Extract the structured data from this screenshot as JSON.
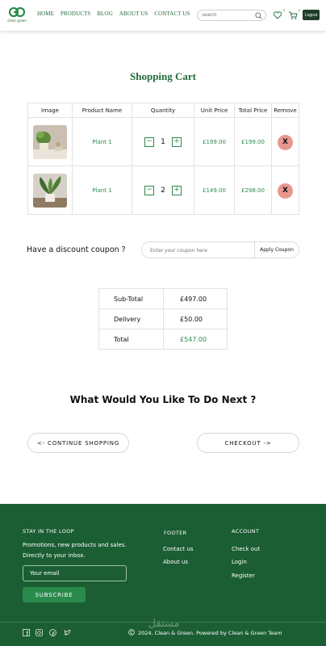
{
  "brand": {
    "name": "clean green",
    "accent": "#1f6b3a",
    "footer_bg": "#1b5e33"
  },
  "nav": {
    "items": [
      "HOME",
      "PRODUCTS",
      "BLOG",
      "ABOUT US",
      "CONTACT US"
    ]
  },
  "search": {
    "placeholder": "search",
    "icon": "search-icon"
  },
  "header_icons": {
    "wishlist_count": "0",
    "cart_count": "0"
  },
  "logout_label": "Logout",
  "page_title": "Shopping Cart",
  "cart": {
    "headers": [
      "Image",
      "Product Name",
      "Quantity",
      "Unit Price",
      "Total Price",
      "Remove"
    ],
    "rows": [
      {
        "name": "Plant 1",
        "qty": "1",
        "unit_price": "£199.00",
        "total_price": "£199.00",
        "remove": "X",
        "minus": "−",
        "plus": "+"
      },
      {
        "name": "Plant 1",
        "qty": "2",
        "unit_price": "£149.00",
        "total_price": "£298.00",
        "remove": "X",
        "minus": "−",
        "plus": "+"
      }
    ]
  },
  "coupon": {
    "label": "Have a discount coupon ?",
    "placeholder": "Enter your coupon here",
    "button": "Apply Coupon"
  },
  "totals": {
    "subtotal_label": "Sub-Total",
    "subtotal": "£497.00",
    "delivery_label": "Delivery",
    "delivery": "£50.00",
    "total_label": "Total",
    "total": "£547.00"
  },
  "next": {
    "title": "What Would You Like To Do Next ?",
    "continue": "<- CONTINUE SHOPPING",
    "checkout": "CHECKOUT ->"
  },
  "footer": {
    "loop_heading": "STAY IN THE LOOP",
    "loop_text": "Promotions, new products and sales. Directly to your inbox.",
    "email_placeholder": "Your email",
    "subscribe": "SUBSCRIBE",
    "footer_heading": "FOOTER",
    "footer_links": [
      "Contact us",
      "About us"
    ],
    "account_heading": "ACCOUNT",
    "account_links": [
      "Check out",
      "Login",
      "Register"
    ],
    "copyright": "2024, Clean & Green. Powered by Clean & Green Team",
    "social_icons": [
      "facebook-icon",
      "instagram-icon",
      "pinterest-icon",
      "twitter-icon"
    ],
    "watermark": "مستقل"
  }
}
